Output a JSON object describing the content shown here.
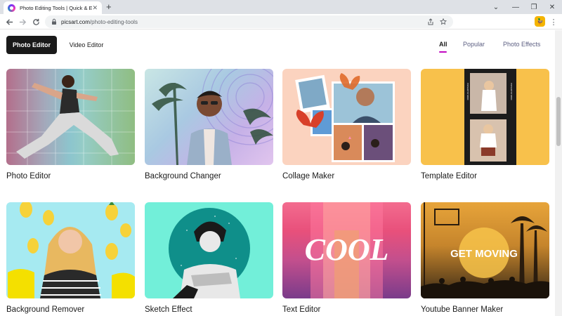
{
  "browser": {
    "tab_title": "Photo Editing Tools | Quick & Easy",
    "tab_close": "✕",
    "new_tab": "+",
    "url_host": "picsart.com",
    "url_path": "/photo-editing-tools",
    "window_controls": [
      "⌄",
      "—",
      "❐",
      "✕"
    ]
  },
  "nav": {
    "primary": [
      {
        "label": "Photo Editor",
        "active": true
      },
      {
        "label": "Video Editor",
        "active": false
      }
    ],
    "filters": [
      {
        "label": "All",
        "active": true
      },
      {
        "label": "Popular",
        "active": false
      },
      {
        "label": "Photo Effects",
        "active": false
      }
    ]
  },
  "tools": [
    {
      "label": "Photo Editor"
    },
    {
      "label": "Background Changer"
    },
    {
      "label": "Collage Maker"
    },
    {
      "label": "Template Editor"
    },
    {
      "label": "Background Remover"
    },
    {
      "label": "Sketch Effect"
    },
    {
      "label": "Text Editor",
      "art_text": "COOL"
    },
    {
      "label": "Youtube Banner Maker",
      "art_text": "GET MOVING"
    }
  ],
  "colors": {
    "accent": "#c209c1",
    "dark_pill": "#1a1a1a"
  }
}
